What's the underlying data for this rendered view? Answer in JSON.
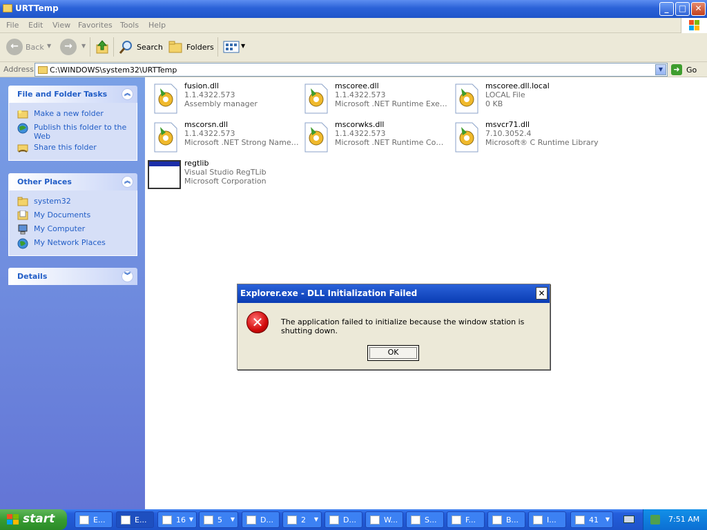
{
  "window": {
    "title": "URTTemp"
  },
  "menu": [
    "File",
    "Edit",
    "View",
    "Favorites",
    "Tools",
    "Help"
  ],
  "toolbar": {
    "back": "Back",
    "search": "Search",
    "folders": "Folders"
  },
  "address": {
    "label": "Address",
    "path": "C:\\WINDOWS\\system32\\URTTemp",
    "go": "Go"
  },
  "left_pane": {
    "tasks": {
      "title": "File and Folder Tasks",
      "items": [
        "Make a new folder",
        "Publish this folder to the Web",
        "Share this folder"
      ]
    },
    "places": {
      "title": "Other Places",
      "items": [
        "system32",
        "My Documents",
        "My Computer",
        "My Network Places"
      ]
    },
    "details": {
      "title": "Details"
    }
  },
  "files": [
    {
      "name": "fusion.dll",
      "version": "1.1.4322.573",
      "description": "Assembly manager"
    },
    {
      "name": "mscoree.dll",
      "version": "1.1.4322.573",
      "description": "Microsoft .NET Runtime Execu..."
    },
    {
      "name": "mscoree.dll.local",
      "version": "LOCAL File",
      "description": "0 KB"
    },
    {
      "name": "mscorsn.dll",
      "version": "1.1.4322.573",
      "description": "Microsoft .NET Strong Name S..."
    },
    {
      "name": "mscorwks.dll",
      "version": "1.1.4322.573",
      "description": "Microsoft .NET Runtime Comm..."
    },
    {
      "name": "msvcr71.dll",
      "version": "7.10.3052.4",
      "description": "Microsoft® C Runtime Library"
    },
    {
      "name": "regtlib",
      "version": "Visual Studio RegTLib",
      "description": "Microsoft Corporation"
    }
  ],
  "dialog": {
    "title": "Explorer.exe - DLL Initialization Failed",
    "message": "The application failed to initialize because the window station is shutting down.",
    "ok": "OK"
  },
  "taskbar": {
    "start": "start",
    "buttons": [
      "E...",
      "E...",
      "16",
      "5",
      "D...",
      "2",
      "D...",
      "W...",
      "S...",
      "F...",
      "B...",
      "I...",
      "41"
    ],
    "clock": "7:51 AM"
  },
  "colors": {
    "accent": "#245edc",
    "link": "#215dc6",
    "error": "#d10a0a"
  }
}
